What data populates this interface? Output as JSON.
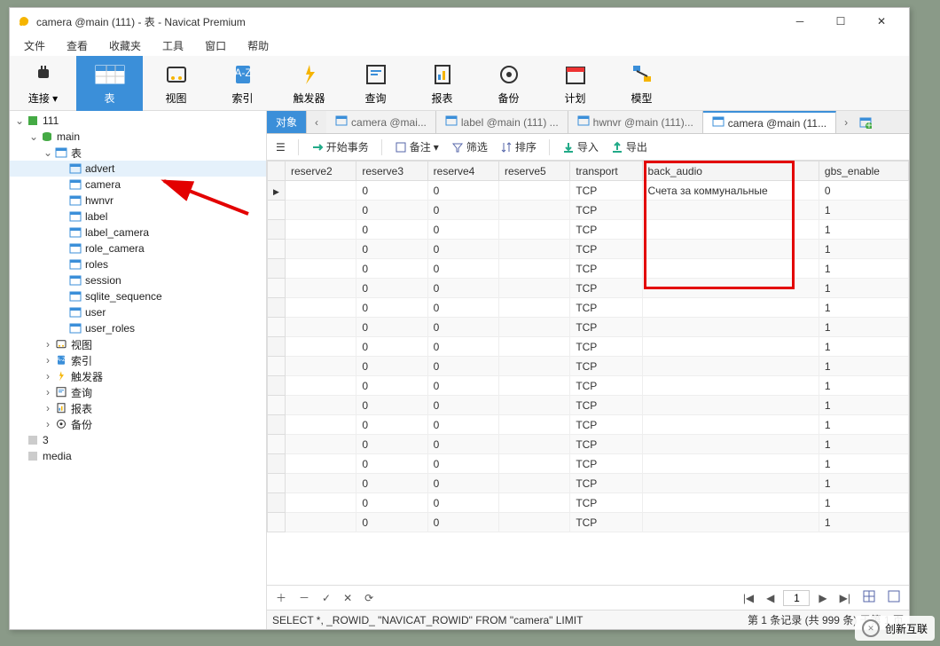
{
  "window": {
    "title": "camera @main (111) - 表 - Navicat Premium"
  },
  "menu": [
    "文件",
    "查看",
    "收藏夹",
    "工具",
    "窗口",
    "帮助"
  ],
  "toolbar": [
    {
      "label": "连接",
      "icon": "plug"
    },
    {
      "label": "表",
      "icon": "table",
      "active": true
    },
    {
      "label": "视图",
      "icon": "view"
    },
    {
      "label": "索引",
      "icon": "index"
    },
    {
      "label": "触发器",
      "icon": "trigger"
    },
    {
      "label": "查询",
      "icon": "query"
    },
    {
      "label": "报表",
      "icon": "report"
    },
    {
      "label": "备份",
      "icon": "backup"
    },
    {
      "label": "计划",
      "icon": "schedule"
    },
    {
      "label": "模型",
      "icon": "model"
    }
  ],
  "tree": {
    "root": "111",
    "db": "main",
    "tables_label": "表",
    "tables": [
      "advert",
      "camera",
      "hwnvr",
      "label",
      "label_camera",
      "role_camera",
      "roles",
      "session",
      "sqlite_sequence",
      "user",
      "user_roles"
    ],
    "other_nodes": [
      {
        "label": "视图",
        "icon": "view"
      },
      {
        "label": "索引",
        "icon": "index"
      },
      {
        "label": "触发器",
        "icon": "trigger"
      },
      {
        "label": "查询",
        "icon": "query"
      },
      {
        "label": "报表",
        "icon": "report"
      },
      {
        "label": "备份",
        "icon": "backup"
      }
    ],
    "extra": [
      "3",
      "media"
    ]
  },
  "tabs": [
    {
      "label": "对象",
      "active": true
    },
    {
      "label": "camera @mai..."
    },
    {
      "label": "label @main (111) ..."
    },
    {
      "label": "hwnvr @main (111)..."
    },
    {
      "label": "camera @main (11...",
      "activefile": true
    }
  ],
  "databar": {
    "begin": "开始事务",
    "comment": "备注",
    "filter": "筛选",
    "sort": "排序",
    "import": "导入",
    "export": "导出"
  },
  "grid": {
    "columns": [
      "reserve2",
      "reserve3",
      "reserve4",
      "reserve5",
      "transport",
      "back_audio",
      "gbs_enable"
    ],
    "rows": [
      {
        "r3": "0",
        "r4": "0",
        "tr": "TCP",
        "ba": "Счета за коммунальные",
        "ge": "0"
      },
      {
        "r3": "0",
        "r4": "0",
        "tr": "TCP",
        "ba": "",
        "ge": "1"
      },
      {
        "r3": "0",
        "r4": "0",
        "tr": "TCP",
        "ba": "",
        "ge": "1"
      },
      {
        "r3": "0",
        "r4": "0",
        "tr": "TCP",
        "ba": "",
        "ge": "1"
      },
      {
        "r3": "0",
        "r4": "0",
        "tr": "TCP",
        "ba": "",
        "ge": "1"
      },
      {
        "r3": "0",
        "r4": "0",
        "tr": "TCP",
        "ba": "",
        "ge": "1"
      },
      {
        "r3": "0",
        "r4": "0",
        "tr": "TCP",
        "ba": "",
        "ge": "1"
      },
      {
        "r3": "0",
        "r4": "0",
        "tr": "TCP",
        "ba": "",
        "ge": "1"
      },
      {
        "r3": "0",
        "r4": "0",
        "tr": "TCP",
        "ba": "",
        "ge": "1"
      },
      {
        "r3": "0",
        "r4": "0",
        "tr": "TCP",
        "ba": "",
        "ge": "1"
      },
      {
        "r3": "0",
        "r4": "0",
        "tr": "TCP",
        "ba": "",
        "ge": "1"
      },
      {
        "r3": "0",
        "r4": "0",
        "tr": "TCP",
        "ba": "",
        "ge": "1"
      },
      {
        "r3": "0",
        "r4": "0",
        "tr": "TCP",
        "ba": "",
        "ge": "1"
      },
      {
        "r3": "0",
        "r4": "0",
        "tr": "TCP",
        "ba": "",
        "ge": "1"
      },
      {
        "r3": "0",
        "r4": "0",
        "tr": "TCP",
        "ba": "",
        "ge": "1"
      },
      {
        "r3": "0",
        "r4": "0",
        "tr": "TCP",
        "ba": "",
        "ge": "1"
      },
      {
        "r3": "0",
        "r4": "0",
        "tr": "TCP",
        "ba": "",
        "ge": "1"
      },
      {
        "r3": "0",
        "r4": "0",
        "tr": "TCP",
        "ba": "",
        "ge": "1"
      }
    ]
  },
  "footer": {
    "page": "1",
    "sql": "SELECT *, _ROWID_ \"NAVICAT_ROWID\" FROM \"camera\" LIMIT",
    "status": "第 1 条记录 (共 999 条) 于第 1 页"
  },
  "watermark": "创新互联"
}
